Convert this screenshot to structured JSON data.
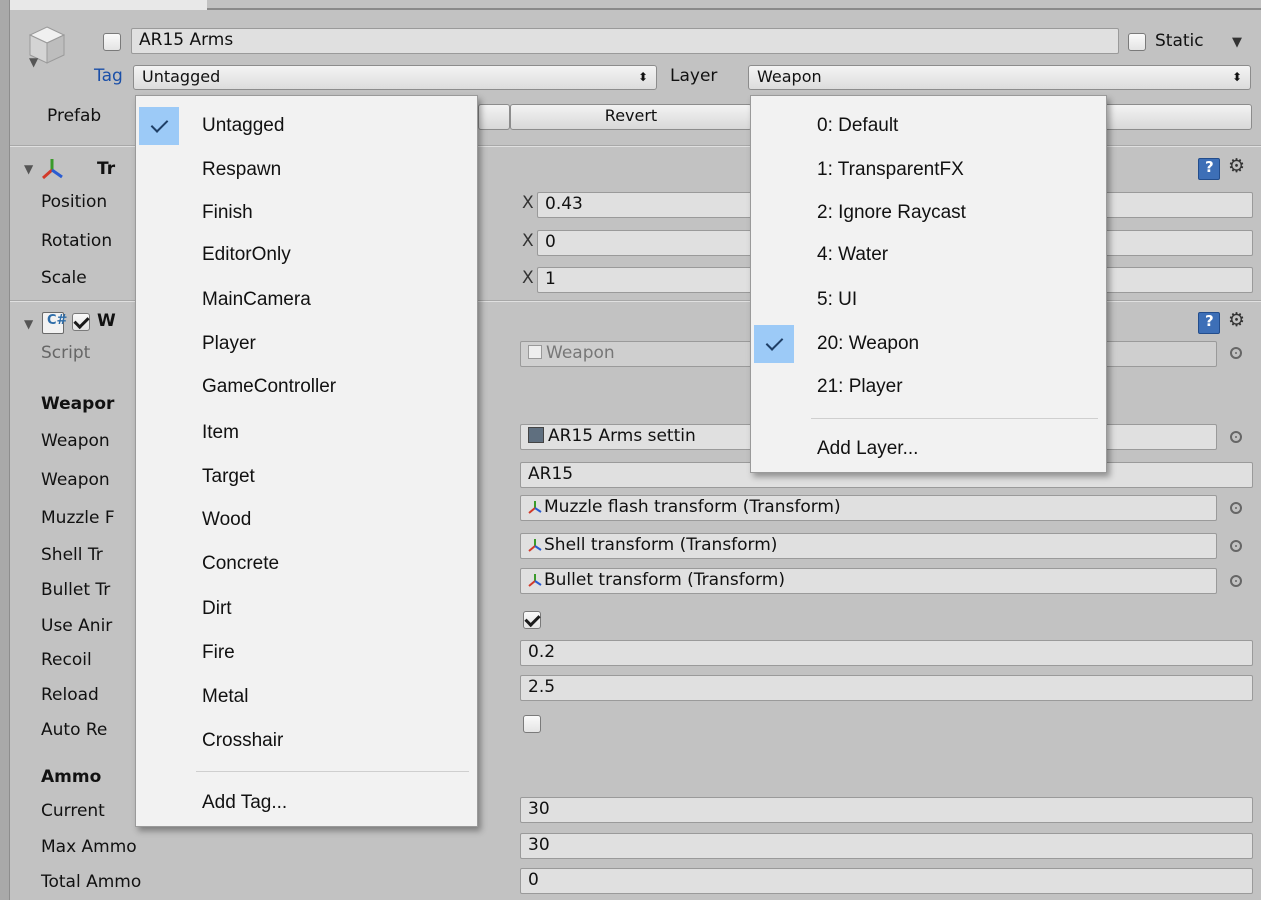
{
  "header": {
    "object_name": "AR15 Arms",
    "static_label": "Static",
    "tag_label": "Tag",
    "tag_value": "Untagged",
    "layer_label": "Layer",
    "layer_value": "Weapon",
    "prefab_label": "Prefab",
    "revert_label": "Revert"
  },
  "transform": {
    "title": "Tr",
    "position_label": "Position",
    "rotation_label": "Rotation",
    "scale_label": "Scale",
    "axis_x": "X",
    "position_x": "0.43",
    "rotation_x": "0",
    "scale_x": "1"
  },
  "weapon_component": {
    "title": "W",
    "script_label": "Script",
    "script_value": "Weapon",
    "section_weapon": "Weapor",
    "rows": [
      {
        "label": "Weapon",
        "value": "AR15 Arms settin"
      },
      {
        "label": "Weapon",
        "value": "AR15"
      },
      {
        "label": "Muzzle F",
        "value": "Muzzle flash transform (Transform)"
      },
      {
        "label": "Shell Tr",
        "value": "Shell transform (Transform)"
      },
      {
        "label": "Bullet Tr",
        "value": "Bullet transform (Transform)"
      },
      {
        "label": "Use Anir",
        "value": ""
      },
      {
        "label": "Recoil",
        "value": "0.2"
      },
      {
        "label": "Reload",
        "value": "2.5"
      },
      {
        "label": "Auto Re",
        "value": ""
      }
    ],
    "section_ammo": "Ammo",
    "ammo_rows": [
      {
        "label": "Current",
        "value": "30"
      },
      {
        "label": "Max Ammo",
        "value": "30"
      },
      {
        "label": "Total Ammo",
        "value": "0"
      }
    ]
  },
  "tag_menu": {
    "items": [
      "Untagged",
      "Respawn",
      "Finish",
      "EditorOnly",
      "MainCamera",
      "Player",
      "GameController",
      "Item",
      "Target",
      "Wood",
      "Concrete",
      "Dirt",
      "Fire",
      "Metal",
      "Crosshair"
    ],
    "selected": "Untagged",
    "add": "Add Tag..."
  },
  "layer_menu": {
    "items": [
      "0: Default",
      "1: TransparentFX",
      "2: Ignore Raycast",
      "4: Water",
      "5: UI",
      "20: Weapon",
      "21: Player"
    ],
    "selected": "20: Weapon",
    "add": "Add Layer..."
  },
  "colors": {
    "inspector_bg": "#c2c2c2",
    "menu_bg": "#f2f2f2",
    "selection": "#9ccaf7",
    "tag_label": "#1a4fa8"
  }
}
